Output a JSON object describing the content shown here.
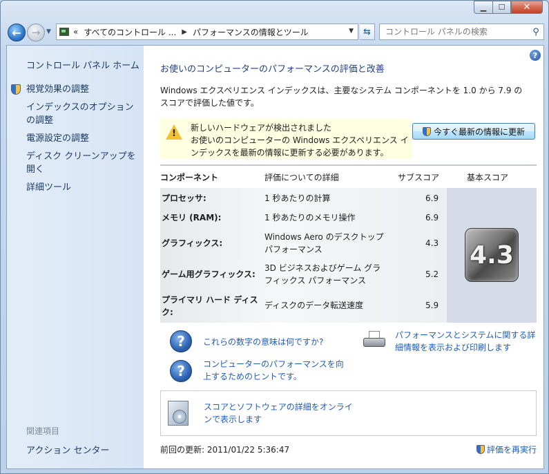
{
  "window": {
    "minimize_glyph": "▁",
    "maximize_glyph": "☐",
    "close_glyph": "✕"
  },
  "navbar": {
    "overflow_marker": "«",
    "breadcrumb": [
      "すべてのコントロール ...",
      "パフォーマンスの情報とツール"
    ],
    "separator": "▶",
    "search_placeholder": "コントロール パネルの検索"
  },
  "sidebar": {
    "home": "コントロール パネル ホーム",
    "items": [
      {
        "label": "視覚効果の調整",
        "icon": "shield-icon"
      },
      {
        "label": "インデックスのオプションの調整",
        "icon": ""
      },
      {
        "label": "電源設定の調整",
        "icon": ""
      },
      {
        "label": "ディスク クリーンアップを開く",
        "icon": ""
      },
      {
        "label": "詳細ツール",
        "icon": ""
      }
    ],
    "related_title": "関連項目",
    "action_center": "アクション センター"
  },
  "main": {
    "title": "お使いのコンピューターのパフォーマンスの評価と改善",
    "intro": "Windows エクスペリエンス インデックスは、主要なシステム コンポーネントを 1.0 から 7.9 のスコアで評価した値です。",
    "notice": {
      "line1": "新しいハードウェアが検出されました",
      "line2": "お使いのコンピューターの Windows エクスペリエンス インデックスを最新の情報に更新する必要があります。"
    },
    "update_button": "今すぐ最新の情報に更新",
    "table": {
      "headers": {
        "component": "コンポーネント",
        "detail": "評価についての詳細",
        "subscore": "サブスコア",
        "basescore": "基本スコア"
      },
      "rows": [
        {
          "name": "プロセッサ:",
          "detail": "1 秒あたりの計算",
          "score": "6.9"
        },
        {
          "name": "メモリ (RAM):",
          "detail": "1 秒あたりのメモリ操作",
          "score": "6.9"
        },
        {
          "name": "グラフィックス:",
          "detail": "Windows Aero のデスクトップ パフォーマンス",
          "score": "4.3"
        },
        {
          "name": "ゲーム用グラフィックス:",
          "detail": "3D ビジネスおよびゲーム グラフィックス パフォーマンス",
          "score": "5.2"
        },
        {
          "name": "プライマリ ハード ディスク:",
          "detail": "ディスクのデータ転送速度",
          "score": "5.9"
        }
      ],
      "base_score": "4.3"
    },
    "links": {
      "what_numbers": "これらの数字の意味は何ですか?",
      "print_details": "パフォーマンスとシステムに関する詳細情報を表示および印刷します",
      "tips": "コンピューターのパフォーマンスを向上するためのヒントです。",
      "online": "スコアとソフトウェアの詳細をオンラインで表示します"
    },
    "last_update": "前回の更新: 2011/01/22 5:36:47",
    "rerun": "評価を再実行"
  }
}
